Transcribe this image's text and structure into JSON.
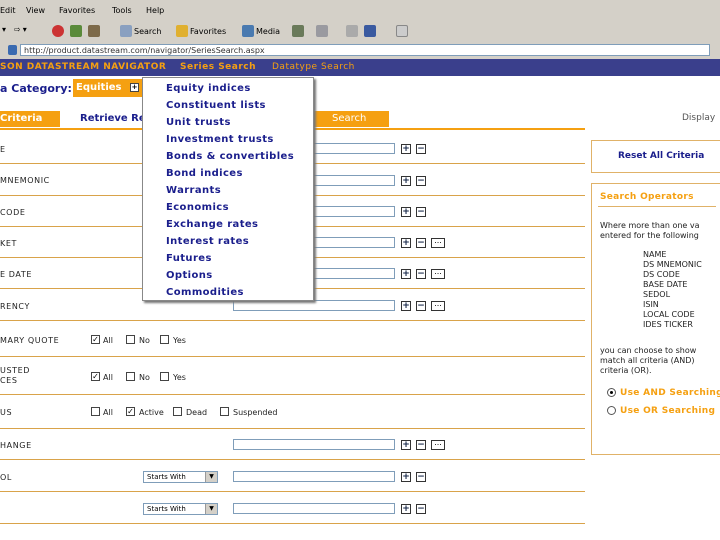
{
  "browser": {
    "menu": [
      "Edit",
      "View",
      "Favorites",
      "Tools",
      "Help"
    ],
    "toolbar": {
      "search": "Search",
      "favorites": "Favorites",
      "media": "Media"
    },
    "address": "http://product.datastream.com/navigator/SeriesSearch.aspx"
  },
  "header": {
    "brand": "SON DATASTREAM NAVIGATOR",
    "nav_series": "Series Search",
    "nav_datatype": "Datatype Search"
  },
  "category": {
    "label": "a Category:",
    "value": "Equities"
  },
  "tabs": {
    "criteria": "Criteria",
    "retrieve": "Retrieve Re",
    "search": "Search",
    "display": "Display"
  },
  "dropdown": [
    "Equity indices",
    "Constituent lists",
    "Unit trusts",
    "Investment trusts",
    "Bonds & convertibles",
    "Bond indices",
    "Warrants",
    "Economics",
    "Exchange rates",
    "Interest rates",
    "Futures",
    "Options",
    "Commodities"
  ],
  "rows": {
    "name": "E",
    "mnemonic": "MNEMONIC",
    "code": "CODE",
    "market": "KET",
    "base_date": "E DATE",
    "currency": "RENCY",
    "primary_quote": "MARY QUOTE",
    "adjusted_1": "USTED",
    "adjusted_2": "CES",
    "status": "US",
    "exchange": "HANGE",
    "sedol": "OL"
  },
  "checks": {
    "all": "All",
    "no": "No",
    "yes": "Yes",
    "active": "Active",
    "dead": "Dead",
    "suspended": "Suspended"
  },
  "selects": {
    "starts_with_1": "Starts With",
    "starts_with_2": "Starts With"
  },
  "reset": "Reset All Criteria",
  "operators": {
    "title": "Search Operators",
    "intro_1": "Where more than one va",
    "intro_2": "entered for the following",
    "fields": [
      "NAME",
      "DS MNEMONIC",
      "DS CODE",
      "BASE DATE",
      "SEDOL",
      "ISIN",
      "LOCAL CODE",
      "IDES TICKER"
    ],
    "note_1": "you can choose to show",
    "note_2": "match all criteria (AND)",
    "note_3": "criteria (OR).",
    "and_option": "Use AND Searching",
    "or_option": "Use OR Searching"
  }
}
